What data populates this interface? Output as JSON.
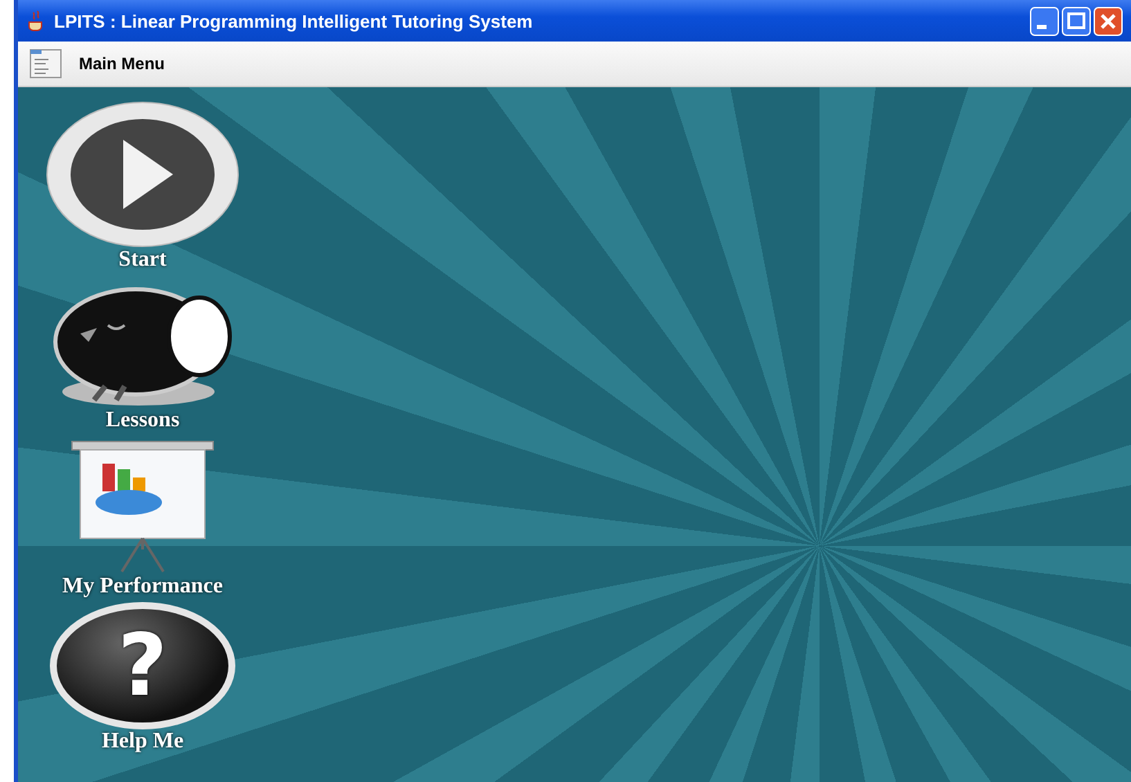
{
  "window": {
    "title": "LPITS : Linear Programming Intelligent Tutoring System"
  },
  "menu_bar": {
    "label": "Main Menu"
  },
  "menu_items": [
    {
      "kind": "play",
      "label": "Start"
    },
    {
      "kind": "bird",
      "label": "Lessons"
    },
    {
      "kind": "chart",
      "label": "My Performance"
    },
    {
      "kind": "help",
      "label": "Help Me",
      "glyph": "?"
    }
  ]
}
